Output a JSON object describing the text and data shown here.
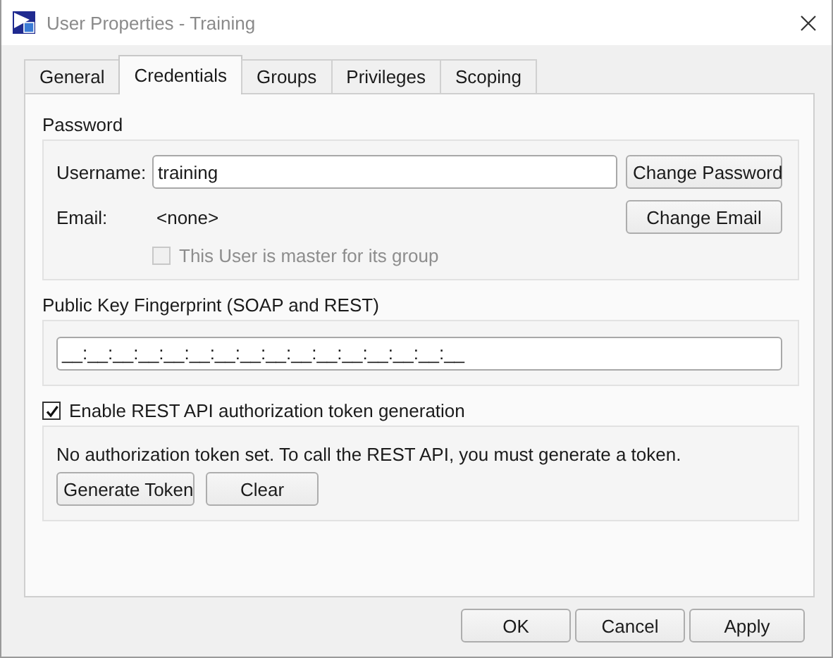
{
  "window": {
    "title": "User Properties - Training"
  },
  "tabs": [
    {
      "label": "General",
      "selected": false
    },
    {
      "label": "Credentials",
      "selected": true
    },
    {
      "label": "Groups",
      "selected": false
    },
    {
      "label": "Privileges",
      "selected": false
    },
    {
      "label": "Scoping",
      "selected": false
    }
  ],
  "password_section": {
    "title": "Password",
    "username_label": "Username:",
    "username_value": "training",
    "change_password_button": "Change Password",
    "email_label": "Email:",
    "email_value": "<none>",
    "change_email_button": "Change Email",
    "master_checkbox": {
      "label": "This User is master for its group",
      "checked": false,
      "disabled": true
    }
  },
  "fingerprint_section": {
    "title": "Public Key Fingerprint (SOAP and REST)",
    "value": "__:__:__:__:__:__:__:__:__:__:__:__:__:__:__:__"
  },
  "rest_token": {
    "checkbox": {
      "label": "Enable REST API authorization token generation",
      "checked": true,
      "disabled": false
    },
    "message": "No authorization token set. To call the REST API, you must generate a token.",
    "buttons": [
      "Generate Token",
      "Clear"
    ]
  },
  "footer_buttons": [
    "OK",
    "Cancel",
    "Apply"
  ]
}
